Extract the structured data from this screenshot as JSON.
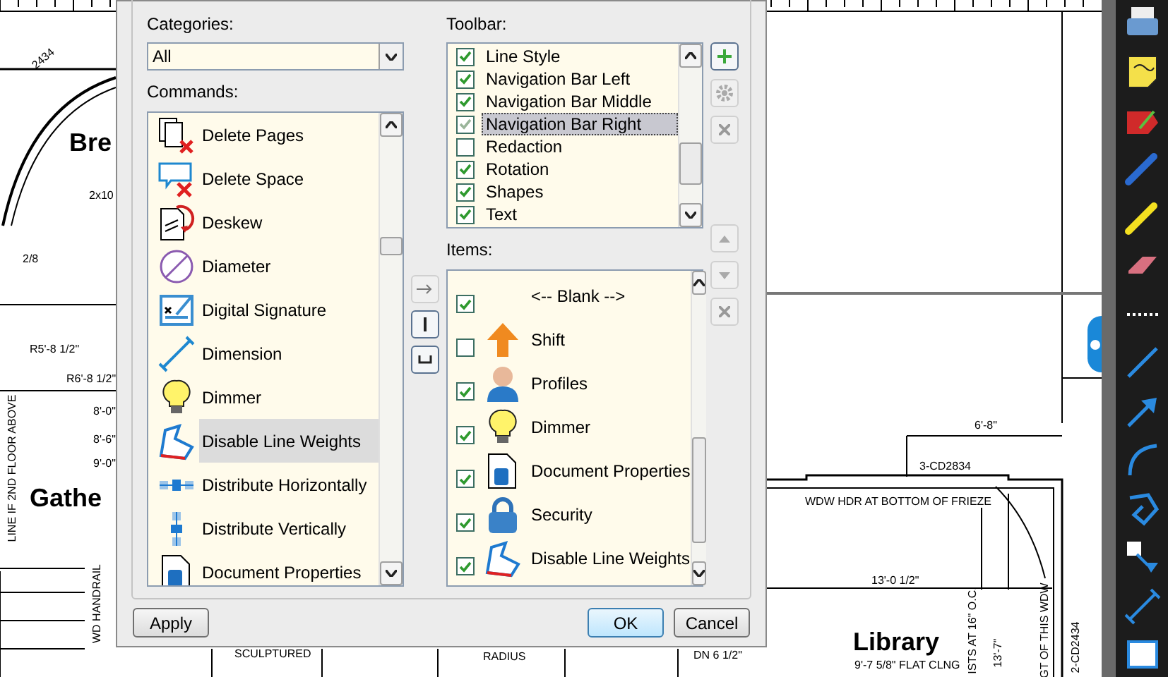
{
  "dialog": {
    "categories_label": "Categories:",
    "category": "All",
    "commands_label": "Commands:",
    "commands": [
      {
        "label": "Delete Pages",
        "selected": false
      },
      {
        "label": "Delete Space",
        "selected": false
      },
      {
        "label": "Deskew",
        "selected": false
      },
      {
        "label": "Diameter",
        "selected": false
      },
      {
        "label": "Digital Signature",
        "selected": false
      },
      {
        "label": "Dimension",
        "selected": false
      },
      {
        "label": "Dimmer",
        "selected": false
      },
      {
        "label": "Disable Line Weights",
        "selected": true
      },
      {
        "label": "Distribute Horizontally",
        "selected": false
      },
      {
        "label": "Distribute Vertically",
        "selected": false
      },
      {
        "label": "Document Properties",
        "selected": false
      }
    ],
    "toolbar_label": "Toolbar:",
    "toolbar": [
      {
        "label": "Line Style",
        "checked": true,
        "selected": false
      },
      {
        "label": "Navigation Bar Left",
        "checked": true,
        "selected": false
      },
      {
        "label": "Navigation Bar Middle",
        "checked": true,
        "selected": false
      },
      {
        "label": "Navigation Bar Right",
        "checked": true,
        "selected": true
      },
      {
        "label": "Redaction",
        "checked": false,
        "selected": false
      },
      {
        "label": "Rotation",
        "checked": true,
        "selected": false
      },
      {
        "label": "Shapes",
        "checked": true,
        "selected": false
      },
      {
        "label": "Text",
        "checked": true,
        "selected": false
      }
    ],
    "items_label": "Items:",
    "items": [
      {
        "label": "<-- Blank -->",
        "checked": true
      },
      {
        "label": "Shift",
        "checked": false
      },
      {
        "label": "Profiles",
        "checked": true
      },
      {
        "label": "Dimmer",
        "checked": true
      },
      {
        "label": "Document Properties",
        "checked": true
      },
      {
        "label": "Security",
        "checked": true
      },
      {
        "label": "Disable Line Weights",
        "checked": true
      }
    ],
    "apply": "Apply",
    "ok": "OK",
    "cancel": "Cancel"
  },
  "drawing_labels": [
    {
      "text": "2434",
      "kind": "slant"
    },
    {
      "text": "Bre",
      "kind": "room"
    },
    {
      "text": "2x10",
      "kind": "note"
    },
    {
      "text": "2/8",
      "kind": "note"
    },
    {
      "text": "R5'-8 1/2\"",
      "kind": "note"
    },
    {
      "text": "R6'-8 1/2\"",
      "kind": "note"
    },
    {
      "text": "8'-0\"",
      "kind": "note"
    },
    {
      "text": "8'-6\"",
      "kind": "note"
    },
    {
      "text": "9'-0\"",
      "kind": "note"
    },
    {
      "text": "Gathe",
      "kind": "room"
    },
    {
      "text": "LINE IF 2ND FLOOR ABOVE",
      "kind": "vertical"
    },
    {
      "text": "WD HANDRAIL",
      "kind": "vertical"
    },
    {
      "text": "SCULPTURED",
      "kind": "note"
    },
    {
      "text": "RADIUS",
      "kind": "note"
    },
    {
      "text": "DN 6 1/2\"",
      "kind": "note"
    },
    {
      "text": "6'-8\"",
      "kind": "note"
    },
    {
      "text": "3-CD2834",
      "kind": "note"
    },
    {
      "text": "WDW HDR AT BOTTOM OF FRIEZE",
      "kind": "note"
    },
    {
      "text": "13'-0 1/2\"",
      "kind": "note"
    },
    {
      "text": "Library",
      "kind": "room"
    },
    {
      "text": "9'-7 5/8\" FLAT CLNG",
      "kind": "note"
    },
    {
      "text": "ISTS AT 16\" O.C.",
      "kind": "vertical"
    },
    {
      "text": "13'-7\"",
      "kind": "vertical"
    },
    {
      "text": "GT OF THIS WDW",
      "kind": "vertical"
    },
    {
      "text": "2-CD2434",
      "kind": "vertical"
    }
  ]
}
